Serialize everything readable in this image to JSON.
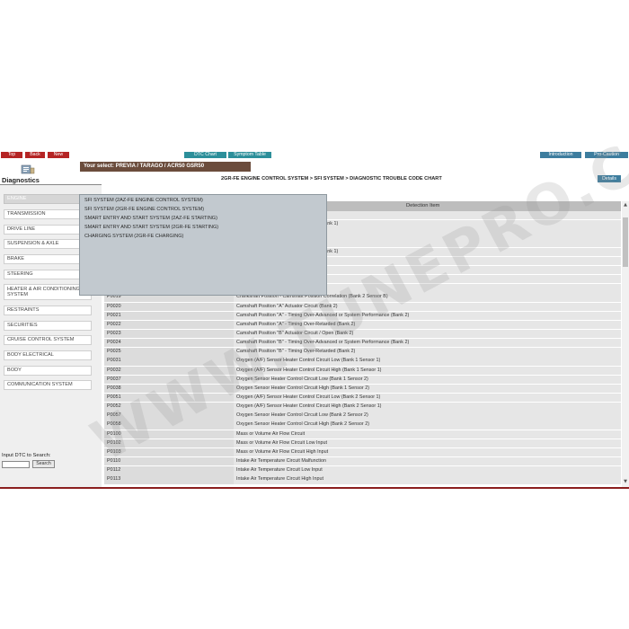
{
  "colors": {
    "nav_red": "#b52424",
    "nav_teal": "#2c8f9a",
    "nav_blue": "#3d7d9e",
    "selection_bar": "#6b4c3c",
    "popup_bg": "#c2c9cf",
    "bottom_bar": "#8b1f1f"
  },
  "toolbar": {
    "top_label": "Top",
    "back_label": "Back",
    "new_label": "New",
    "dtc_chart_label": "DTC Chart",
    "symptom_table_label": "Symptom Table",
    "introduction_label": "Introduction",
    "precaution_label": "Pro-Caution"
  },
  "header": {
    "selection_text": "Your select: PREVIA / TARAGO / ACR50 GSR50",
    "diagnostics_title": "Diagnostics",
    "breadcrumb": "2GR-FE ENGINE CONTROL SYSTEM > SFI SYSTEM > DIAGNOSTIC TROUBLE CODE CHART",
    "details_label": "Details",
    "icon": "book-icon"
  },
  "sidebar": {
    "items": [
      {
        "label": "ENGINE"
      },
      {
        "label": "TRANSMISSION"
      },
      {
        "label": "DRIVE LINE"
      },
      {
        "label": "SUSPENSION & AXLE"
      },
      {
        "label": "BRAKE"
      },
      {
        "label": "STEERING"
      },
      {
        "label": "HEATER & AIR CONDITIONING SYSTEM"
      },
      {
        "label": "RESTRAINTS"
      },
      {
        "label": "SECURITIES"
      },
      {
        "label": "CRUISE CONTROL SYSTEM"
      },
      {
        "label": "BODY ELECTRICAL"
      },
      {
        "label": "BODY"
      },
      {
        "label": "COMMUNICATION SYSTEM"
      }
    ],
    "search_label": "Input DTC to Search:",
    "search_value": "",
    "search_button": "Search"
  },
  "popup": {
    "items": [
      "SFI SYSTEM (2AZ-FE ENGINE CONTROL SYSTEM)",
      "SFI SYSTEM (2GR-FE ENGINE CONTROL SYSTEM)",
      "SMART ENTRY AND START SYSTEM (2AZ-FE STARTING)",
      "SMART ENTRY AND START SYSTEM (2GR-FE STARTING)",
      "CHARGING SYSTEM (2GR-FE CHARGING)"
    ]
  },
  "table": {
    "header_item": "Detection Item",
    "rows": [
      {
        "code": "",
        "item": "ircuit (Bank 1)"
      },
      {
        "code": "",
        "item": "ver-Advanced or System Performance (Bank 1)"
      },
      {
        "code": "",
        "item": "ver-Retarded (Bank 1)"
      },
      {
        "code": "",
        "item": "rcuit / Open (Bank 1)"
      },
      {
        "code": "",
        "item": "ver-Advanced or System Performance (Bank 1)"
      },
      {
        "code": "",
        "item": "ver-Retarded (Bank 1)"
      },
      {
        "code": "",
        "item": "osition Correlation (Bank 1 Sensor A)"
      },
      {
        "code": "",
        "item": "osition Correlation (Bank 1 Sensor B)"
      },
      {
        "code": "",
        "item": "osition Correlation (Bank 2 Sensor A)"
      },
      {
        "code": "P0019",
        "item": "Crankshaft Position - Camshaft Position Correlation (Bank 2 Sensor B)"
      },
      {
        "code": "P0020",
        "item": "Camshaft Position \"A\" Actuator Circuit (Bank 2)"
      },
      {
        "code": "P0021",
        "item": "Camshaft Position \"A\" - Timing Over-Advanced or System Performance (Bank 2)"
      },
      {
        "code": "P0022",
        "item": "Camshaft Position \"A\" - Timing Over-Retarded (Bank 2)"
      },
      {
        "code": "P0023",
        "item": "Camshaft Position \"B\" Actuator Circuit / Open (Bank 2)"
      },
      {
        "code": "P0024",
        "item": "Camshaft Position \"B\" - Timing Over-Advanced or System Performance (Bank 2)"
      },
      {
        "code": "P0025",
        "item": "Camshaft Position \"B\" - Timing Over-Retarded (Bank 2)"
      },
      {
        "code": "P0031",
        "item": "Oxygen (A/F) Sensor Heater Control Circuit Low (Bank 1 Sensor 1)"
      },
      {
        "code": "P0032",
        "item": "Oxygen (A/F) Sensor Heater Control Circuit High (Bank 1 Sensor 1)"
      },
      {
        "code": "P0037",
        "item": "Oxygen Sensor Heater Control Circuit Low (Bank 1 Sensor 2)"
      },
      {
        "code": "P0038",
        "item": "Oxygen Sensor Heater Control Circuit High (Bank 1 Sensor 2)"
      },
      {
        "code": "P0051",
        "item": "Oxygen (A/F) Sensor Heater Control Circuit Low (Bank 2 Sensor 1)"
      },
      {
        "code": "P0052",
        "item": "Oxygen (A/F) Sensor Heater Control Circuit High (Bank 2 Sensor 1)"
      },
      {
        "code": "P0057",
        "item": "Oxygen Sensor Heater Control Circuit Low (Bank 2 Sensor 2)"
      },
      {
        "code": "P0058",
        "item": "Oxygen Sensor Heater Control Circuit High (Bank 2 Sensor 2)"
      },
      {
        "code": "P0100",
        "item": "Mass or Volume Air Flow Circuit"
      },
      {
        "code": "P0102",
        "item": "Mass or Volume Air Flow Circuit Low Input"
      },
      {
        "code": "P0103",
        "item": "Mass or Volume Air Flow Circuit High Input"
      },
      {
        "code": "P0110",
        "item": "Intake Air Temperature Circuit Malfunction"
      },
      {
        "code": "P0112",
        "item": "Intake Air Temperature Circuit Low Input"
      },
      {
        "code": "P0113",
        "item": "Intake Air Temperature Circuit High Input"
      }
    ]
  },
  "watermark": "WWW.TUNEPRO.COM"
}
